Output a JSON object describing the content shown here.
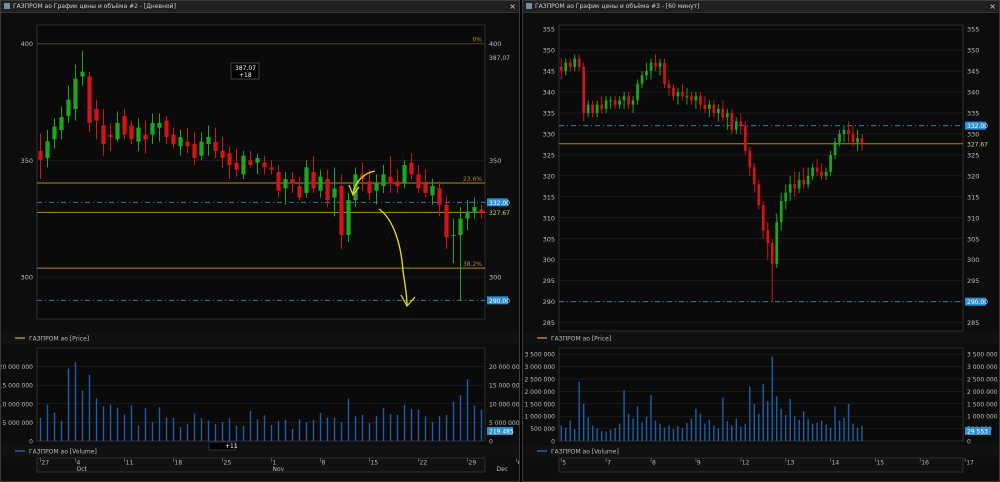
{
  "theme": {
    "up": "#1fa51f",
    "down": "#d21414",
    "fib": "#b08a1e",
    "dash": "#2f7fb5",
    "grid": "#2a2a2a",
    "axis": "#bdbdbd",
    "vol": "#1f5ea8",
    "tag": "#2b8fd0",
    "tagtext": "#ffffff",
    "cursor": "#ffffff",
    "annot": "#e8e030"
  },
  "icons": {
    "close": "close-icon",
    "window": "window-icon"
  },
  "left_window": {
    "title": "ГАЗПРОМ ао График цены и объёма #2 - [Дневной]",
    "close_glyph": "×",
    "price_legend": "ГАЗПРОМ ао [Price]",
    "volume_legend": "ГАЗПРОМ ао [Volume]",
    "crosshair_box": {
      "price": "387,07",
      "change": "+18"
    },
    "top_right_value": "387,07",
    "cursor_badge": "+11"
  },
  "right_window": {
    "title": "ГАЗПРОМ ао График цены и объёма #3 - [60 минут]",
    "close_glyph": "×",
    "price_legend": "ГАЗПРОМ ао [Price]",
    "volume_legend": "ГАЗПРОМ ао [Volume]"
  },
  "chart_data": [
    {
      "type": "candlestick",
      "timeframe": "daily",
      "price_ylim": [
        282,
        408
      ],
      "price_ticks": [
        300,
        350,
        400
      ],
      "volume_ylim": [
        0,
        25000000
      ],
      "volume_ticks": [
        "20 000 000",
        "15 000 000",
        "10 000 000",
        "5 000 000",
        "0"
      ],
      "volume_tick_values": [
        20000000,
        15000000,
        10000000,
        5000000,
        0
      ],
      "x_day_labels": [
        "27",
        "4",
        "11",
        "18",
        "25",
        "1",
        "8",
        "15",
        "22",
        "29",
        "6",
        "13"
      ],
      "x_day_index": [
        0,
        5,
        12,
        19,
        26,
        33,
        40,
        47,
        54,
        61,
        68,
        75
      ],
      "x_month_labels": [
        "Oct",
        "Nov",
        "Dec"
      ],
      "x_month_index": [
        5,
        33,
        65
      ],
      "fib_levels": [
        {
          "label": "0%",
          "value": 400
        },
        {
          "label": "23.6%",
          "value": 340.3
        },
        {
          "label": "38.2%",
          "value": 303.8
        }
      ],
      "horizontal_levels": [
        {
          "value": 327.67,
          "label": "327.67",
          "style": "solid",
          "tag": "plain"
        },
        {
          "value": 332.0,
          "label": "332.00",
          "style": "dash",
          "tag": "blue"
        },
        {
          "value": 290.0,
          "label": "290.00",
          "style": "dash",
          "tag": "blue"
        }
      ],
      "last_volume_label": "219 485",
      "candles_ohlc": [
        [
          354.0,
          361.5,
          342.0,
          350.2
        ],
        [
          351.0,
          363.0,
          347.0,
          358.2
        ],
        [
          359.0,
          368.0,
          355.0,
          364.5
        ],
        [
          363.0,
          373.0,
          359.0,
          368.5
        ],
        [
          369.0,
          382.0,
          366.0,
          376.0
        ],
        [
          372.0,
          391.0,
          367.0,
          385.0
        ],
        [
          386.0,
          397.0,
          382.0,
          388.0
        ],
        [
          386.0,
          388.0,
          362.0,
          366.0
        ],
        [
          372.0,
          376.0,
          359.0,
          367.0
        ],
        [
          365.0,
          372.0,
          352.0,
          357.0
        ],
        [
          361.0,
          366.0,
          354.0,
          360.0
        ],
        [
          359.0,
          371.0,
          358.0,
          366.0
        ],
        [
          369.0,
          372.0,
          359.0,
          361.0
        ],
        [
          365.0,
          367.0,
          357.0,
          359.0
        ],
        [
          358.0,
          368.0,
          354.0,
          364.0
        ],
        [
          361.0,
          367.0,
          353.0,
          359.0
        ],
        [
          361.0,
          370.0,
          357.0,
          366.0
        ],
        [
          364.0,
          370.0,
          358.0,
          366.0
        ],
        [
          367.0,
          369.0,
          357.0,
          360.0
        ],
        [
          361.0,
          364.0,
          355.0,
          357.0
        ],
        [
          356.0,
          363.0,
          352.0,
          360.0
        ],
        [
          358.0,
          364.0,
          353.0,
          356.0
        ],
        [
          357.0,
          362.0,
          348.0,
          351.0
        ],
        [
          352.0,
          362.0,
          350.0,
          358.0
        ],
        [
          357.0,
          365.0,
          352.0,
          360.0
        ],
        [
          358.0,
          364.0,
          351.0,
          354.0
        ],
        [
          354.0,
          360.0,
          347.0,
          351.0
        ],
        [
          353.0,
          356.0,
          342.0,
          348.0
        ],
        [
          349.0,
          355.0,
          343.0,
          346.0
        ],
        [
          344.0,
          354.0,
          342.0,
          352.0
        ],
        [
          350.0,
          354.0,
          347.0,
          348.0
        ],
        [
          349.0,
          353.0,
          344.0,
          351.0
        ],
        [
          349.0,
          352.0,
          344.0,
          347.0
        ],
        [
          347.0,
          350.0,
          344.0,
          346.0
        ],
        [
          345.0,
          348.0,
          334.0,
          337.0
        ],
        [
          338.0,
          345.0,
          331.0,
          342.0
        ],
        [
          342.0,
          345.0,
          336.0,
          340.0
        ],
        [
          339.0,
          343.0,
          333.0,
          334.0
        ],
        [
          336.0,
          350.0,
          334.0,
          347.0
        ],
        [
          345.0,
          352.0,
          336.0,
          338.0
        ],
        [
          337.0,
          346.0,
          334.0,
          343.0
        ],
        [
          342.0,
          346.0,
          330.0,
          333.0
        ],
        [
          334.0,
          347.0,
          326.0,
          338.0
        ],
        [
          339.0,
          344.0,
          312.0,
          318.0
        ],
        [
          318.0,
          336.0,
          315.0,
          333.0
        ],
        [
          333.0,
          347.0,
          330.0,
          344.0
        ],
        [
          344.0,
          349.0,
          337.0,
          342.0
        ],
        [
          341.0,
          346.0,
          333.0,
          336.0
        ],
        [
          337.0,
          344.0,
          331.0,
          340.0
        ],
        [
          339.0,
          348.0,
          336.0,
          344.0
        ],
        [
          343.0,
          352.0,
          336.0,
          340.0
        ],
        [
          341.0,
          346.0,
          336.0,
          339.0
        ],
        [
          340.0,
          350.0,
          338.0,
          348.0
        ],
        [
          349.0,
          353.0,
          342.0,
          344.0
        ],
        [
          344.0,
          348.0,
          336.0,
          338.0
        ],
        [
          340.0,
          346.0,
          334.0,
          336.0
        ],
        [
          335.0,
          342.0,
          331.0,
          339.0
        ],
        [
          338.0,
          341.0,
          326.0,
          331.0
        ],
        [
          331.0,
          335.0,
          312.0,
          317.0
        ],
        [
          318.0,
          325.0,
          306.0,
          318.0
        ],
        [
          318.0,
          330.0,
          290.0,
          325.0
        ],
        [
          325.0,
          333.0,
          320.0,
          328.0
        ],
        [
          328.0,
          334.0,
          325.0,
          330.0
        ],
        [
          329.0,
          331.0,
          325.0,
          327.67
        ]
      ],
      "volumes": [
        6200000,
        9800000,
        7600000,
        5400000,
        19500000,
        21200000,
        13600000,
        17800000,
        11500000,
        9300000,
        9800000,
        9000000,
        7100000,
        9600000,
        4200000,
        8800000,
        5100000,
        9100000,
        6300000,
        6200000,
        3800000,
        4600000,
        7400000,
        6100000,
        5500000,
        4500000,
        5100000,
        6100000,
        4100000,
        4000000,
        8100000,
        5800000,
        6900000,
        4300000,
        5400000,
        5700000,
        3300000,
        5800000,
        5000000,
        5700000,
        7600000,
        6300000,
        6200000,
        5000000,
        11400000,
        6600000,
        7000000,
        4800000,
        6700000,
        8800000,
        7200000,
        7000000,
        9700000,
        8600000,
        8400000,
        6600000,
        5100000,
        6700000,
        7000000,
        10600000,
        12300000,
        16600000,
        9600000,
        8400000
      ]
    },
    {
      "type": "candlestick",
      "timeframe": "60 minutes",
      "price_ylim": [
        283,
        356
      ],
      "price_ticks": [
        285,
        290,
        295,
        300,
        305,
        310,
        315,
        320,
        325,
        330,
        335,
        340,
        345,
        350,
        355
      ],
      "volume_ylim": [
        0,
        3750000
      ],
      "volume_ticks": [
        "3 500 000",
        "3 000 000",
        "2 500 000",
        "2 000 000",
        "1 500 000",
        "1 000 000",
        "500 000",
        "0"
      ],
      "volume_tick_values": [
        3500000,
        3000000,
        2500000,
        2000000,
        1500000,
        1000000,
        500000,
        0
      ],
      "x_day_labels": [
        "5",
        "7",
        "8",
        "9",
        "12",
        "13",
        "14",
        "15",
        "16",
        "17"
      ],
      "x_day_index": [
        0,
        10,
        20,
        30,
        40,
        50,
        60,
        70,
        80,
        90
      ],
      "horizontal_levels": [
        {
          "value": 327.67,
          "label": "327.67",
          "style": "solid",
          "tag": "plain"
        },
        {
          "value": 332.0,
          "label": "332.00",
          "style": "dash",
          "tag": "blue"
        },
        {
          "value": 290.0,
          "label": "290.00",
          "style": "dash",
          "tag": "blue"
        }
      ],
      "last_volume_label": "29 553",
      "candles_ohlc": [
        [
          346.0,
          348.0,
          343.0,
          345.0
        ],
        [
          345.0,
          348.0,
          344.0,
          347.0
        ],
        [
          347.0,
          348.0,
          345.0,
          346.0
        ],
        [
          346.0,
          349.0,
          345.0,
          348.0
        ],
        [
          348.0,
          349.0,
          345.0,
          346.0
        ],
        [
          346.0,
          347.0,
          333.0,
          335.0
        ],
        [
          335.0,
          338.0,
          334.0,
          337.0
        ],
        [
          337.0,
          338.0,
          334.0,
          335.0
        ],
        [
          335.0,
          338.0,
          334.0,
          337.0
        ],
        [
          337.0,
          339.0,
          335.0,
          336.0
        ],
        [
          336.0,
          339.0,
          335.0,
          338.0
        ],
        [
          338.0,
          339.0,
          336.0,
          338.0
        ],
        [
          338.0,
          339.0,
          336.0,
          337.0
        ],
        [
          337.0,
          339.0,
          336.0,
          338.0
        ],
        [
          338.0,
          340.0,
          336.0,
          339.0
        ],
        [
          339.0,
          340.0,
          336.0,
          337.0
        ],
        [
          337.0,
          339.0,
          335.0,
          338.0
        ],
        [
          338.0,
          343.0,
          337.0,
          342.0
        ],
        [
          342.0,
          345.0,
          341.0,
          344.0
        ],
        [
          344.0,
          347.0,
          343.0,
          345.0
        ],
        [
          345.0,
          348.0,
          343.0,
          347.0
        ],
        [
          347.0,
          349.0,
          345.0,
          346.0
        ],
        [
          346.0,
          348.0,
          344.0,
          347.0
        ],
        [
          347.0,
          348.0,
          341.0,
          342.0
        ],
        [
          342.0,
          343.0,
          339.0,
          341.0
        ],
        [
          341.0,
          342.0,
          338.0,
          339.0
        ],
        [
          339.0,
          341.0,
          337.0,
          340.0
        ],
        [
          340.0,
          342.0,
          338.0,
          339.0
        ],
        [
          339.0,
          341.0,
          337.0,
          339.0
        ],
        [
          339.0,
          340.0,
          337.0,
          338.0
        ],
        [
          338.0,
          340.0,
          336.0,
          339.0
        ],
        [
          339.0,
          340.0,
          336.0,
          337.0
        ],
        [
          337.0,
          339.0,
          335.0,
          336.0
        ],
        [
          336.0,
          338.0,
          334.0,
          337.0
        ],
        [
          337.0,
          338.0,
          334.0,
          335.0
        ],
        [
          335.0,
          337.0,
          333.0,
          336.0
        ],
        [
          336.0,
          338.0,
          333.0,
          334.0
        ],
        [
          334.0,
          336.0,
          331.0,
          335.0
        ],
        [
          335.0,
          336.0,
          330.0,
          331.0
        ],
        [
          331.0,
          334.0,
          330.0,
          333.0
        ],
        [
          333.0,
          335.0,
          330.0,
          332.0
        ],
        [
          332.0,
          333.0,
          325.0,
          326.0
        ],
        [
          326.0,
          327.0,
          320.0,
          322.0
        ],
        [
          322.0,
          323.0,
          316.0,
          318.0
        ],
        [
          318.0,
          319.0,
          312.0,
          313.0
        ],
        [
          313.0,
          314.0,
          305.0,
          307.0
        ],
        [
          307.0,
          309.0,
          300.0,
          304.0
        ],
        [
          304.0,
          305.0,
          290.0,
          299.0
        ],
        [
          299.0,
          311.0,
          298.0,
          309.0
        ],
        [
          309.0,
          316.0,
          307.0,
          314.0
        ],
        [
          314.0,
          318.0,
          312.0,
          316.0
        ],
        [
          316.0,
          320.0,
          314.0,
          318.0
        ],
        [
          318.0,
          321.0,
          315.0,
          317.0
        ],
        [
          317.0,
          321.0,
          316.0,
          319.0
        ],
        [
          319.0,
          322.0,
          317.0,
          318.0
        ],
        [
          318.0,
          322.0,
          317.0,
          320.0
        ],
        [
          320.0,
          323.0,
          319.0,
          322.0
        ],
        [
          322.0,
          324.0,
          320.0,
          321.0
        ],
        [
          321.0,
          323.0,
          319.0,
          320.0
        ],
        [
          320.0,
          322.0,
          319.0,
          321.0
        ],
        [
          321.0,
          326.0,
          320.0,
          325.0
        ],
        [
          325.0,
          329.0,
          324.0,
          328.0
        ],
        [
          328.0,
          331.0,
          327.0,
          330.0
        ],
        [
          330.0,
          332.0,
          328.0,
          331.0
        ],
        [
          331.0,
          333.0,
          328.0,
          330.0
        ],
        [
          330.0,
          332.0,
          327.0,
          328.0
        ],
        [
          328.0,
          331.0,
          326.0,
          329.0
        ],
        [
          329.0,
          330.0,
          326.0,
          327.67
        ]
      ],
      "volumes": [
        620000,
        540000,
        820000,
        480000,
        2400000,
        1500000,
        950000,
        620000,
        510000,
        400000,
        380000,
        460000,
        520000,
        700000,
        2050000,
        1100000,
        900000,
        1400000,
        760000,
        980000,
        1850000,
        820000,
        700000,
        540000,
        620000,
        480000,
        600000,
        520000,
        730000,
        900000,
        1300000,
        1100000,
        700000,
        860000,
        640000,
        520000,
        1750000,
        800000,
        620000,
        900000,
        560000,
        700000,
        2200000,
        1500000,
        1100000,
        2300000,
        1600000,
        3400000,
        1800000,
        1300000,
        1050000,
        1700000,
        1000000,
        860000,
        1200000,
        900000,
        700000,
        740000,
        820000,
        660000,
        540000,
        1400000,
        820000,
        940000,
        1500000,
        700000,
        540000,
        620000
      ]
    }
  ]
}
